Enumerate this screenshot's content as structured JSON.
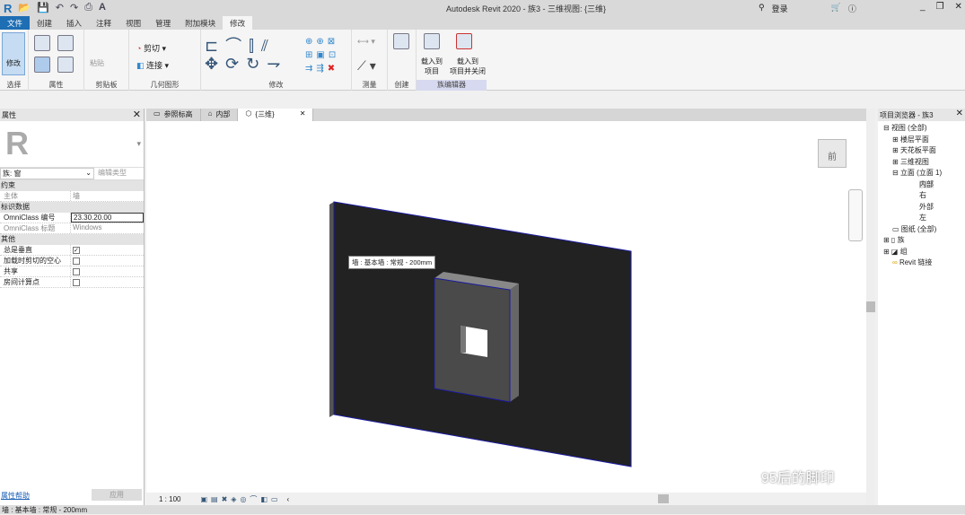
{
  "title": "Autodesk Revit 2020 - 族3 - 三维视图: {三维}",
  "login": "登录",
  "menu_tabs": [
    "文件",
    "创建",
    "插入",
    "注释",
    "视图",
    "管理",
    "附加模块",
    "修改"
  ],
  "ribbon": {
    "modify": "修改",
    "panels": [
      "选择",
      "属性",
      "剪贴板",
      "几何图形",
      "修改",
      "测量",
      "创建",
      "族编辑器"
    ],
    "paste": "粘贴",
    "cut": "剪切",
    "join": "连接",
    "load_project": "载入到\n项目",
    "load_close": "载入到\n项目并关闭"
  },
  "properties": {
    "title": "属性",
    "family": "族: 窗",
    "edit_type": "编辑类型",
    "groups": [
      {
        "name": "约束",
        "rows": [
          {
            "k": "主体",
            "v": "墙"
          }
        ]
      },
      {
        "name": "标识数据",
        "rows": [
          {
            "k": "OmniClass 编号",
            "v": "23.30.20.00"
          },
          {
            "k": "OmniClass 标题",
            "v": "Windows"
          }
        ]
      },
      {
        "name": "其他",
        "rows": [
          {
            "k": "总是垂直",
            "v": "✓"
          },
          {
            "k": "加载时剪切的空心",
            "v": ""
          },
          {
            "k": "共享",
            "v": ""
          },
          {
            "k": "房间计算点",
            "v": ""
          }
        ]
      }
    ],
    "help": "属性帮助",
    "apply": "应用"
  },
  "view_tabs": [
    "参照标高",
    "内部",
    "{三维}"
  ],
  "viewcube_face": "前",
  "tooltip": "墙 : 基本墙 : 常规 - 200mm",
  "scale": "1 : 100",
  "watermark": "95后的脚印",
  "browser": {
    "title": "项目浏览器 - 族3",
    "items": [
      "视图 (全部)",
      "楼层平面",
      "天花板平面",
      "三维视图",
      "立面 (立面 1)",
      "内部",
      "右",
      "外部",
      "左",
      "图纸 (全部)",
      "族",
      "组",
      "Revit 链接"
    ]
  },
  "status": "墙 : 基本墙 : 常规 - 200mm"
}
